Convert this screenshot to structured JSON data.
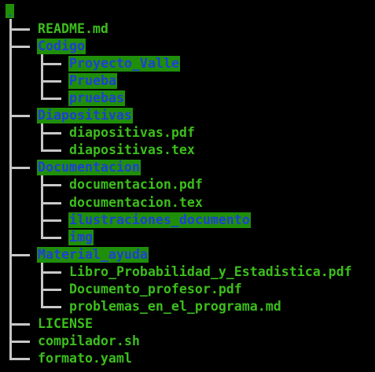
{
  "root": {
    "label": "."
  },
  "entries": [
    {
      "name": "README.md",
      "type": "file",
      "depth": 1
    },
    {
      "name": "Codigo",
      "type": "dir",
      "depth": 1
    },
    {
      "name": "Proyecto_Valle",
      "type": "dir",
      "depth": 2
    },
    {
      "name": "Prueba",
      "type": "dir",
      "depth": 2
    },
    {
      "name": "pruebas",
      "type": "dir",
      "depth": 2,
      "last": true
    },
    {
      "name": "Diapositivas",
      "type": "dir",
      "depth": 1
    },
    {
      "name": "diapositivas.pdf",
      "type": "file",
      "depth": 2
    },
    {
      "name": "diapositivas.tex",
      "type": "file",
      "depth": 2,
      "last": true
    },
    {
      "name": "Documentacion",
      "type": "dir",
      "depth": 1
    },
    {
      "name": "documentacion.pdf",
      "type": "file",
      "depth": 2
    },
    {
      "name": "documentacion.tex",
      "type": "file",
      "depth": 2
    },
    {
      "name": "ilustraciones_documento",
      "type": "dir",
      "depth": 2
    },
    {
      "name": "img",
      "type": "dir",
      "depth": 2,
      "last": true
    },
    {
      "name": "Material_ayuda",
      "type": "dir",
      "depth": 1
    },
    {
      "name": "Libro_Probabilidad_y_Estadistica.pdf",
      "type": "file",
      "depth": 2
    },
    {
      "name": "Documento_profesor.pdf",
      "type": "file",
      "depth": 2
    },
    {
      "name": "problemas_en_el_programa.md",
      "type": "file",
      "depth": 2,
      "last": true
    },
    {
      "name": "LICENSE",
      "type": "file",
      "depth": 1
    },
    {
      "name": "compilador.sh",
      "type": "file",
      "depth": 1
    },
    {
      "name": "formato.yaml",
      "type": "file",
      "depth": 1,
      "last": true
    }
  ],
  "colors": {
    "background": "#000000",
    "file_text": "#3cbe1c",
    "dir_text": "#1f3fd6",
    "dir_highlight": "#1f8f0a",
    "tree_lines": "#c8c8c8"
  }
}
